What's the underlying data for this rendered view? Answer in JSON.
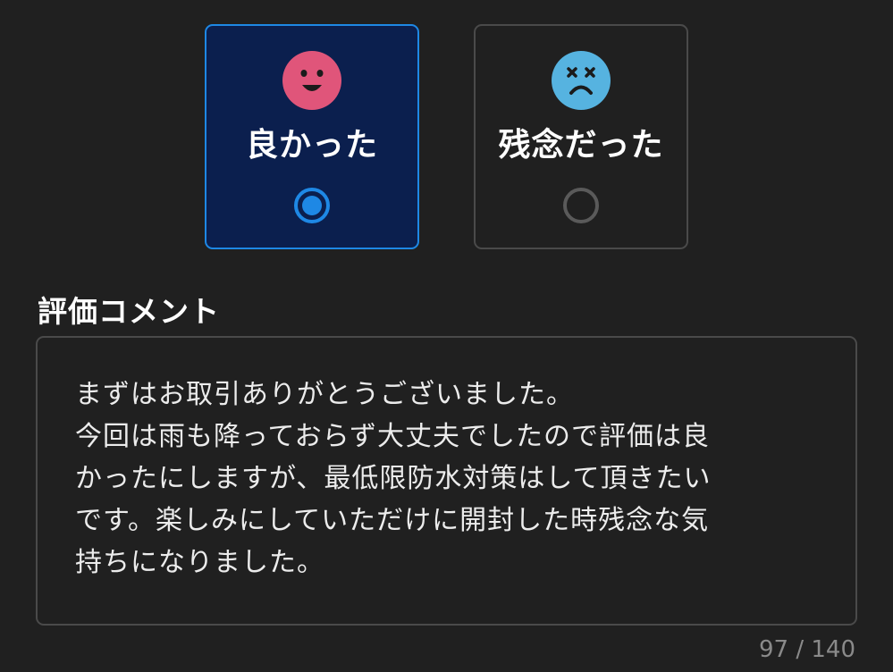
{
  "ratings": {
    "good": {
      "label": "良かった",
      "selected": true,
      "icon": "smiley-face-icon",
      "color": "#e0557a"
    },
    "bad": {
      "label": "残念だった",
      "selected": false,
      "icon": "dizzy-face-icon",
      "color": "#56b3e0"
    }
  },
  "comment": {
    "title": "評価コメント",
    "lines": [
      "まずはお取引ありがとうございました。",
      "今回は雨も降っておらず大丈夫でしたので評価は良",
      "かったにしますが、最低限防水対策はして頂きたい",
      "です。楽しみにしていただけに開封した時残念な気",
      "持ちになりました。"
    ],
    "counter": "97 / 140"
  },
  "colors": {
    "accent": "#1e88e5",
    "selected_bg": "#0b1f4e",
    "background": "#202020",
    "border": "#4a4a4a"
  }
}
